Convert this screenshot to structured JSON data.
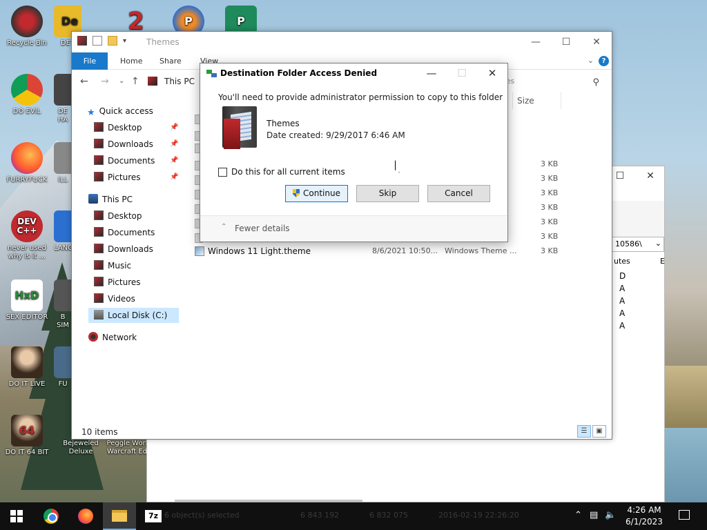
{
  "desktop": {
    "icons": [
      {
        "label": "Recycle Bin"
      },
      {
        "label": "DET"
      },
      {
        "label": "DO EVIL"
      },
      {
        "label": "DE HA"
      },
      {
        "label": "FURRYFUCK"
      },
      {
        "label": "ILL"
      },
      {
        "label": "never used why is it ..."
      },
      {
        "label": "LANG"
      },
      {
        "label": "SEX EDITOR"
      },
      {
        "label": "B SIM"
      },
      {
        "label": "DO IT LIVE"
      },
      {
        "label": "FU"
      },
      {
        "label": "DO IT 64 BIT"
      },
      {
        "label": "Bejeweled Deluxe"
      },
      {
        "label": "Peggle Worl Warcraft Ed"
      }
    ]
  },
  "back_window": {
    "path": "10586\\",
    "col_partial_1": "utes",
    "col_partial_2": "E",
    "attributes": [
      "D",
      "A",
      "A",
      "A",
      "A"
    ],
    "status_ghost": "6 object(s) selected",
    "status_num1": "6 843 192",
    "status_num2": "6 832 075",
    "status_date": "2016-02-19 22:26:20"
  },
  "explorer": {
    "title": "Themes",
    "tabs": {
      "file": "File",
      "home": "Home",
      "share": "Share",
      "view": "View"
    },
    "breadcrumb": "This PC",
    "search_partial": "mes",
    "nav": {
      "quick_access": "Quick access",
      "qa_items": [
        "Desktop",
        "Downloads",
        "Documents",
        "Pictures"
      ],
      "this_pc": "This PC",
      "pc_items": [
        "Desktop",
        "Documents",
        "Downloads",
        "Music",
        "Pictures",
        "Videos",
        "Local Disk (C:)"
      ],
      "network": "Network"
    },
    "size_header": "Size",
    "sizes": [
      "3 KB",
      "3 KB",
      "3 KB",
      "3 KB",
      "3 KB",
      "3 KB"
    ],
    "last_file": {
      "name": "Windows 11 Light.theme",
      "date": "8/6/2021 10:50...",
      "type": "Windows Theme ...",
      "size": "3 KB"
    },
    "status": "10 items"
  },
  "dialog": {
    "title": "Destination Folder Access Denied",
    "message": "You'll need to provide administrator permission to copy to this folder",
    "folder_name": "Themes",
    "date_created": "Date created: 9/29/2017 6:46 AM",
    "checkbox_label": "Do this for all current items",
    "continue_label": "Continue",
    "skip_label": "Skip",
    "cancel_label": "Cancel",
    "fewer_details": "Fewer details"
  },
  "taskbar": {
    "time": "4:26 AM",
    "date": "6/1/2023"
  }
}
